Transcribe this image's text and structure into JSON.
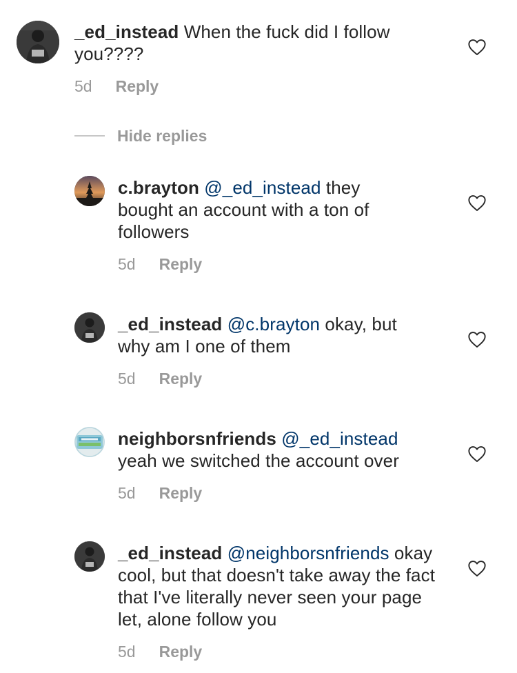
{
  "comments": [
    {
      "username": "_ed_instead",
      "mention": "",
      "text": " When the fuck did I follow you????",
      "time": "5d",
      "reply_label": "Reply"
    },
    {
      "username": "c.brayton",
      "mention": "@_ed_instead",
      "text": " they bought an account with a ton of followers",
      "time": "5d",
      "reply_label": "Reply"
    },
    {
      "username": "_ed_instead",
      "mention": "@c.brayton",
      "text": " okay, but why am I one of them",
      "time": "5d",
      "reply_label": "Reply"
    },
    {
      "username": "neighborsnfriends",
      "mention": "@_ed_instead",
      "text": " yeah we switched the account over",
      "time": "5d",
      "reply_label": "Reply"
    },
    {
      "username": "_ed_instead",
      "mention": "@neighborsnfriends",
      "text": " okay cool, but that doesn't take away the fact that I've literally never seen your page let, alone follow you",
      "time": "5d",
      "reply_label": "Reply"
    }
  ],
  "hide_replies_label": "Hide replies",
  "icons": {
    "like": "heart-outline-icon"
  },
  "colors": {
    "text": "#262626",
    "mention": "#003569",
    "meta": "#999999"
  }
}
